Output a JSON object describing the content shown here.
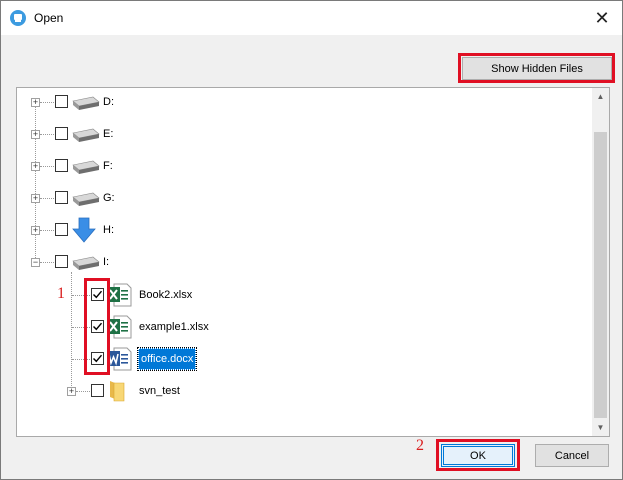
{
  "window": {
    "title": "Open",
    "close_symbol": "✕"
  },
  "toolbar": {
    "show_hidden_label": "Show Hidden Files"
  },
  "tree": {
    "drives": [
      {
        "label": "D:",
        "icon": "drive-icon",
        "expander": "+"
      },
      {
        "label": "E:",
        "icon": "drive-icon",
        "expander": "+"
      },
      {
        "label": "F:",
        "icon": "drive-icon",
        "expander": "+"
      },
      {
        "label": "G:",
        "icon": "drive-icon",
        "expander": "+"
      },
      {
        "label": "H:",
        "icon": "download-arrow-icon",
        "expander": "+"
      },
      {
        "label": "I:",
        "icon": "drive-icon",
        "expander": "−"
      }
    ],
    "children": [
      {
        "label": "Book2.xlsx",
        "icon": "excel-file-icon",
        "checked": true,
        "selected": false
      },
      {
        "label": "example1.xlsx",
        "icon": "excel-file-icon",
        "checked": true,
        "selected": false
      },
      {
        "label": "office.docx",
        "icon": "word-file-icon",
        "checked": true,
        "selected": true
      },
      {
        "label": "svn_test",
        "icon": "folder-icon",
        "checked": false,
        "selected": false,
        "expander": "+"
      }
    ]
  },
  "annotations": {
    "marker_1": "1",
    "marker_2": "2"
  },
  "footer": {
    "ok_label": "OK",
    "cancel_label": "Cancel"
  },
  "colors": {
    "highlight": "#e00f23",
    "selection": "#0078d7",
    "excel": "#1e7145",
    "word": "#2b579a",
    "folder": "#f8d775"
  }
}
